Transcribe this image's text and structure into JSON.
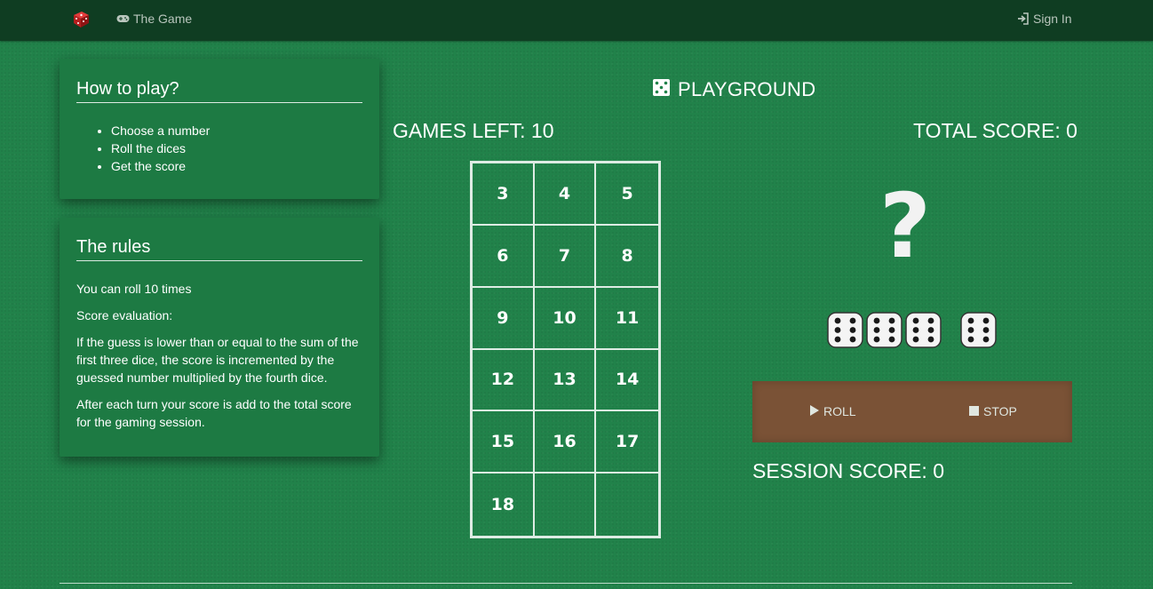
{
  "navbar": {
    "brand_icon": "red-dice-icon",
    "game_link": "The Game",
    "game_icon": "gamepad-icon",
    "signin_link": "Sign In",
    "signin_icon": "sign-in-icon"
  },
  "how_to_play": {
    "title": "How to play?",
    "steps": [
      "Choose a number",
      "Roll the dices",
      "Get the score"
    ]
  },
  "rules": {
    "title": "The rules",
    "paragraphs": [
      "You can roll 10 times",
      "Score evaluation:",
      "If the guess is lower than or equal to the sum of the first three dice, the score is incremented by the guessed number multiplied by the fourth dice.",
      "After each turn your score is add to the total score for the gaming session."
    ]
  },
  "playground": {
    "title": "PLAYGROUND",
    "title_icon": "dice-icon",
    "games_left": "GAMES LEFT: 10",
    "total_score": "TOTAL SCORE: 0",
    "numbers": [
      "3",
      "4",
      "5",
      "6",
      "7",
      "8",
      "9",
      "10",
      "11",
      "12",
      "13",
      "14",
      "15",
      "16",
      "17",
      "18"
    ],
    "guess_placeholder": "?",
    "dice": [
      "die-six-icon",
      "die-six-icon",
      "die-six-icon",
      "die-six-icon"
    ],
    "roll_label": "ROLL",
    "roll_icon": "play-icon",
    "stop_label": "STOP",
    "stop_icon": "stop-icon",
    "session_score": "SESSION SCORE: 0"
  },
  "colors": {
    "background": "#21824a",
    "navbar": "#0f3d22",
    "panel": "#1d7a43",
    "control_bar": "#7a5236"
  }
}
